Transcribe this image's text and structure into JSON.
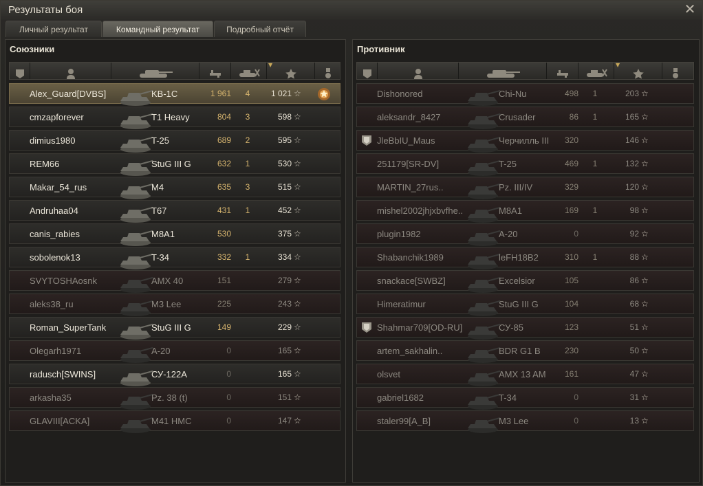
{
  "window": {
    "title": "Результаты боя"
  },
  "tabs": [
    {
      "label": "Личный результат",
      "active": false
    },
    {
      "label": "Командный результат",
      "active": true
    },
    {
      "label": "Подробный отчёт",
      "active": false
    }
  ],
  "allies": {
    "title": "Союзники",
    "rows": [
      {
        "player": "Alex_Guard[DVBS]",
        "vehicle": "KB-1C",
        "damage": "1 961",
        "kills": "4",
        "xp": "1 021",
        "alive": true,
        "me": true,
        "medal": true
      },
      {
        "player": "cmzapforever",
        "vehicle": "T1 Heavy",
        "damage": "804",
        "kills": "3",
        "xp": "598",
        "alive": true
      },
      {
        "player": "dimius1980",
        "vehicle": "T-25",
        "damage": "689",
        "kills": "2",
        "xp": "595",
        "alive": true
      },
      {
        "player": "REM66",
        "vehicle": "StuG III G",
        "damage": "632",
        "kills": "1",
        "xp": "530",
        "alive": true
      },
      {
        "player": "Makar_54_rus",
        "vehicle": "M4",
        "damage": "635",
        "kills": "3",
        "xp": "515",
        "alive": true
      },
      {
        "player": "Andruhaa04",
        "vehicle": "T67",
        "damage": "431",
        "kills": "1",
        "xp": "452",
        "alive": true
      },
      {
        "player": "canis_rabies",
        "vehicle": "M8A1",
        "damage": "530",
        "kills": "",
        "xp": "375",
        "alive": true
      },
      {
        "player": "sobolenok13",
        "vehicle": "T-34",
        "damage": "332",
        "kills": "1",
        "xp": "334",
        "alive": true
      },
      {
        "player": "SVYTOSHAosnk",
        "vehicle": "AMX 40",
        "damage": "151",
        "kills": "",
        "xp": "279",
        "alive": false
      },
      {
        "player": "aleks38_ru",
        "vehicle": "M3 Lee",
        "damage": "225",
        "kills": "",
        "xp": "243",
        "alive": false
      },
      {
        "player": "Roman_SuperTank",
        "vehicle": "StuG III G",
        "damage": "149",
        "kills": "",
        "xp": "229",
        "alive": true
      },
      {
        "player": "Olegarh1971",
        "vehicle": "A-20",
        "damage": "0",
        "kills": "",
        "xp": "165",
        "alive": false
      },
      {
        "player": "radusch[SWINS]",
        "vehicle": "СУ-122А",
        "damage": "0",
        "kills": "",
        "xp": "165",
        "alive": true
      },
      {
        "player": "arkasha35",
        "vehicle": "Pz. 38 (t)",
        "damage": "0",
        "kills": "",
        "xp": "151",
        "alive": false
      },
      {
        "player": "GLAVIII[ACKA]",
        "vehicle": "M41 HMC",
        "damage": "0",
        "kills": "",
        "xp": "147",
        "alive": false
      }
    ]
  },
  "enemies": {
    "title": "Противник",
    "rows": [
      {
        "player": "Dishonored",
        "vehicle": "Chi-Nu",
        "damage": "498",
        "kills": "1",
        "xp": "203",
        "alive": false
      },
      {
        "player": "aleksandr_8427",
        "vehicle": "Crusader",
        "damage": "86",
        "kills": "1",
        "xp": "165",
        "alive": false
      },
      {
        "player": "JleBbIU_Maus",
        "vehicle": "Черчилль III",
        "damage": "320",
        "kills": "",
        "xp": "146",
        "alive": false,
        "badge": true
      },
      {
        "player": "251179[SR-DV]",
        "vehicle": "T-25",
        "damage": "469",
        "kills": "1",
        "xp": "132",
        "alive": false
      },
      {
        "player": "MARTIN_27rus..",
        "vehicle": "Pz. III/IV",
        "damage": "329",
        "kills": "",
        "xp": "120",
        "alive": false
      },
      {
        "player": "mishel2002jhjxbvfhe..",
        "vehicle": "M8A1",
        "damage": "169",
        "kills": "1",
        "xp": "98",
        "alive": false
      },
      {
        "player": "plugin1982",
        "vehicle": "A-20",
        "damage": "0",
        "kills": "",
        "xp": "92",
        "alive": false
      },
      {
        "player": "Shabanchik1989",
        "vehicle": "leFH18B2",
        "damage": "310",
        "kills": "1",
        "xp": "88",
        "alive": false
      },
      {
        "player": "snackace[SWBZ]",
        "vehicle": "Excelsior",
        "damage": "105",
        "kills": "",
        "xp": "86",
        "alive": false
      },
      {
        "player": "Himeratimur",
        "vehicle": "StuG III G",
        "damage": "104",
        "kills": "",
        "xp": "68",
        "alive": false
      },
      {
        "player": "Shahmar709[OD-RU]",
        "vehicle": "СУ-85",
        "damage": "123",
        "kills": "",
        "xp": "51",
        "alive": false,
        "badge": true
      },
      {
        "player": "artem_sakhalin..",
        "vehicle": "BDR G1 B",
        "damage": "230",
        "kills": "",
        "xp": "50",
        "alive": false
      },
      {
        "player": "olsvet",
        "vehicle": "AMX 13 AM",
        "damage": "161",
        "kills": "",
        "xp": "47",
        "alive": false
      },
      {
        "player": "gabriel1682",
        "vehicle": "T-34",
        "damage": "0",
        "kills": "",
        "xp": "31",
        "alive": false
      },
      {
        "player": "staler99[A_B]",
        "vehicle": "M3 Lee",
        "damage": "0",
        "kills": "",
        "xp": "13",
        "alive": false
      }
    ]
  },
  "icons": {
    "star": "☆",
    "close": "✕"
  },
  "colors": {
    "accent_damage": "#d6b46e",
    "alive_text": "#ece7da",
    "dead_text": "#8c8880",
    "highlight_row": "#6a5f45"
  }
}
